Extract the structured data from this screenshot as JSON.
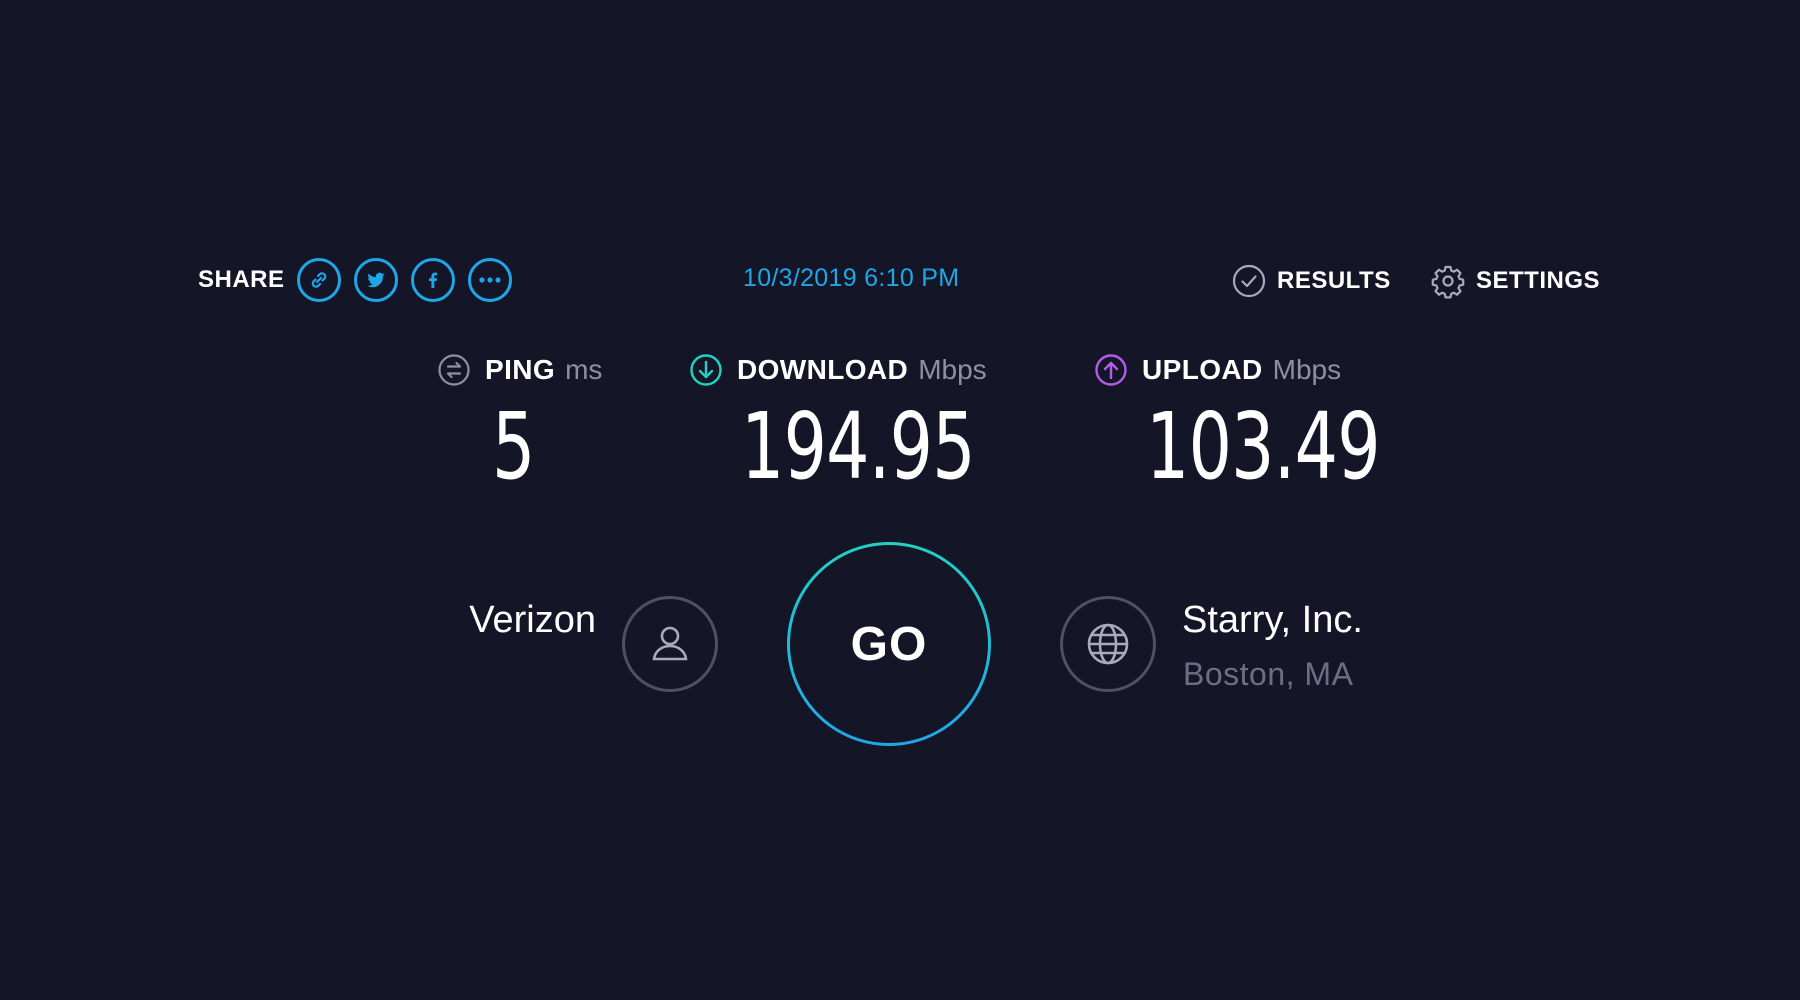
{
  "share": {
    "label": "SHARE",
    "buttons": [
      "link-icon",
      "twitter-icon",
      "facebook-icon",
      "more-icon"
    ]
  },
  "timestamp": "10/3/2019 6:10 PM",
  "nav": {
    "results_label": "RESULTS",
    "settings_label": "SETTINGS"
  },
  "metrics": {
    "ping": {
      "name": "PING",
      "unit": "ms",
      "value": "5",
      "icon": "ping-icon"
    },
    "download": {
      "name": "DOWNLOAD",
      "unit": "Mbps",
      "value": "194.95",
      "icon": "download-icon",
      "color": "#22d0c4"
    },
    "upload": {
      "name": "UPLOAD",
      "unit": "Mbps",
      "value": "103.49",
      "icon": "upload-icon",
      "color": "#b45ce8"
    }
  },
  "isp": {
    "name": "Verizon",
    "icon": "user-icon"
  },
  "go": {
    "label": "GO"
  },
  "server": {
    "name": "Starry, Inc.",
    "location": "Boston, MA",
    "icon": "globe-icon"
  },
  "colors": {
    "background": "#141628",
    "accent": "#1ea7e6",
    "download": "#22d0c4",
    "upload": "#b45ce8",
    "muted": "#8d8fa6"
  }
}
